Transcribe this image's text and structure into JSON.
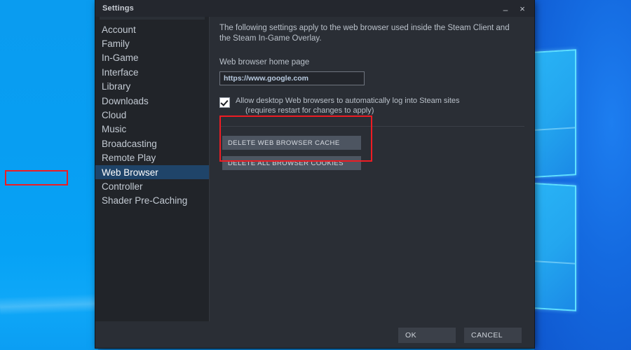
{
  "desktop": {
    "wallpaper_name": "windows-10-wallpaper",
    "left_color": "#0a9cf0",
    "right_color": "#146ae0",
    "logo_accent": "#5fe0ff"
  },
  "window": {
    "title": "Settings",
    "minimize_label": "–",
    "close_label": "×",
    "bg_color": "#2a2e35"
  },
  "sidebar": {
    "selected": "Web Browser",
    "selection_color": "#1f4469",
    "items": [
      {
        "label": "Account"
      },
      {
        "label": "Family"
      },
      {
        "label": "In-Game"
      },
      {
        "label": "Interface"
      },
      {
        "label": "Library"
      },
      {
        "label": "Downloads"
      },
      {
        "label": "Cloud"
      },
      {
        "label": "Music"
      },
      {
        "label": "Broadcasting"
      },
      {
        "label": "Remote Play"
      },
      {
        "label": "Web Browser"
      },
      {
        "label": "Controller"
      },
      {
        "label": "Shader Pre-Caching"
      }
    ]
  },
  "content": {
    "description": "The following settings apply to the web browser used inside the Steam Client and the Steam In-Game Overlay.",
    "home_page_label": "Web browser home page",
    "home_page_value": "https://www.google.com",
    "home_page_placeholder": "https://",
    "checkbox": {
      "checked": true,
      "label_line1": "Allow desktop Web browsers to automatically log into Steam sites",
      "label_line2": "(requires restart for changes to apply)"
    },
    "delete_buttons": [
      {
        "label": "DELETE WEB BROWSER CACHE"
      },
      {
        "label": "DELETE ALL BROWSER COOKIES"
      }
    ]
  },
  "footer": {
    "ok_label": "OK",
    "cancel_label": "CANCEL"
  },
  "annotations": {
    "color": "#ee1c23",
    "nav_highlight_target": "Web Browser",
    "delete_group_highlight_target": "delete buttons"
  }
}
